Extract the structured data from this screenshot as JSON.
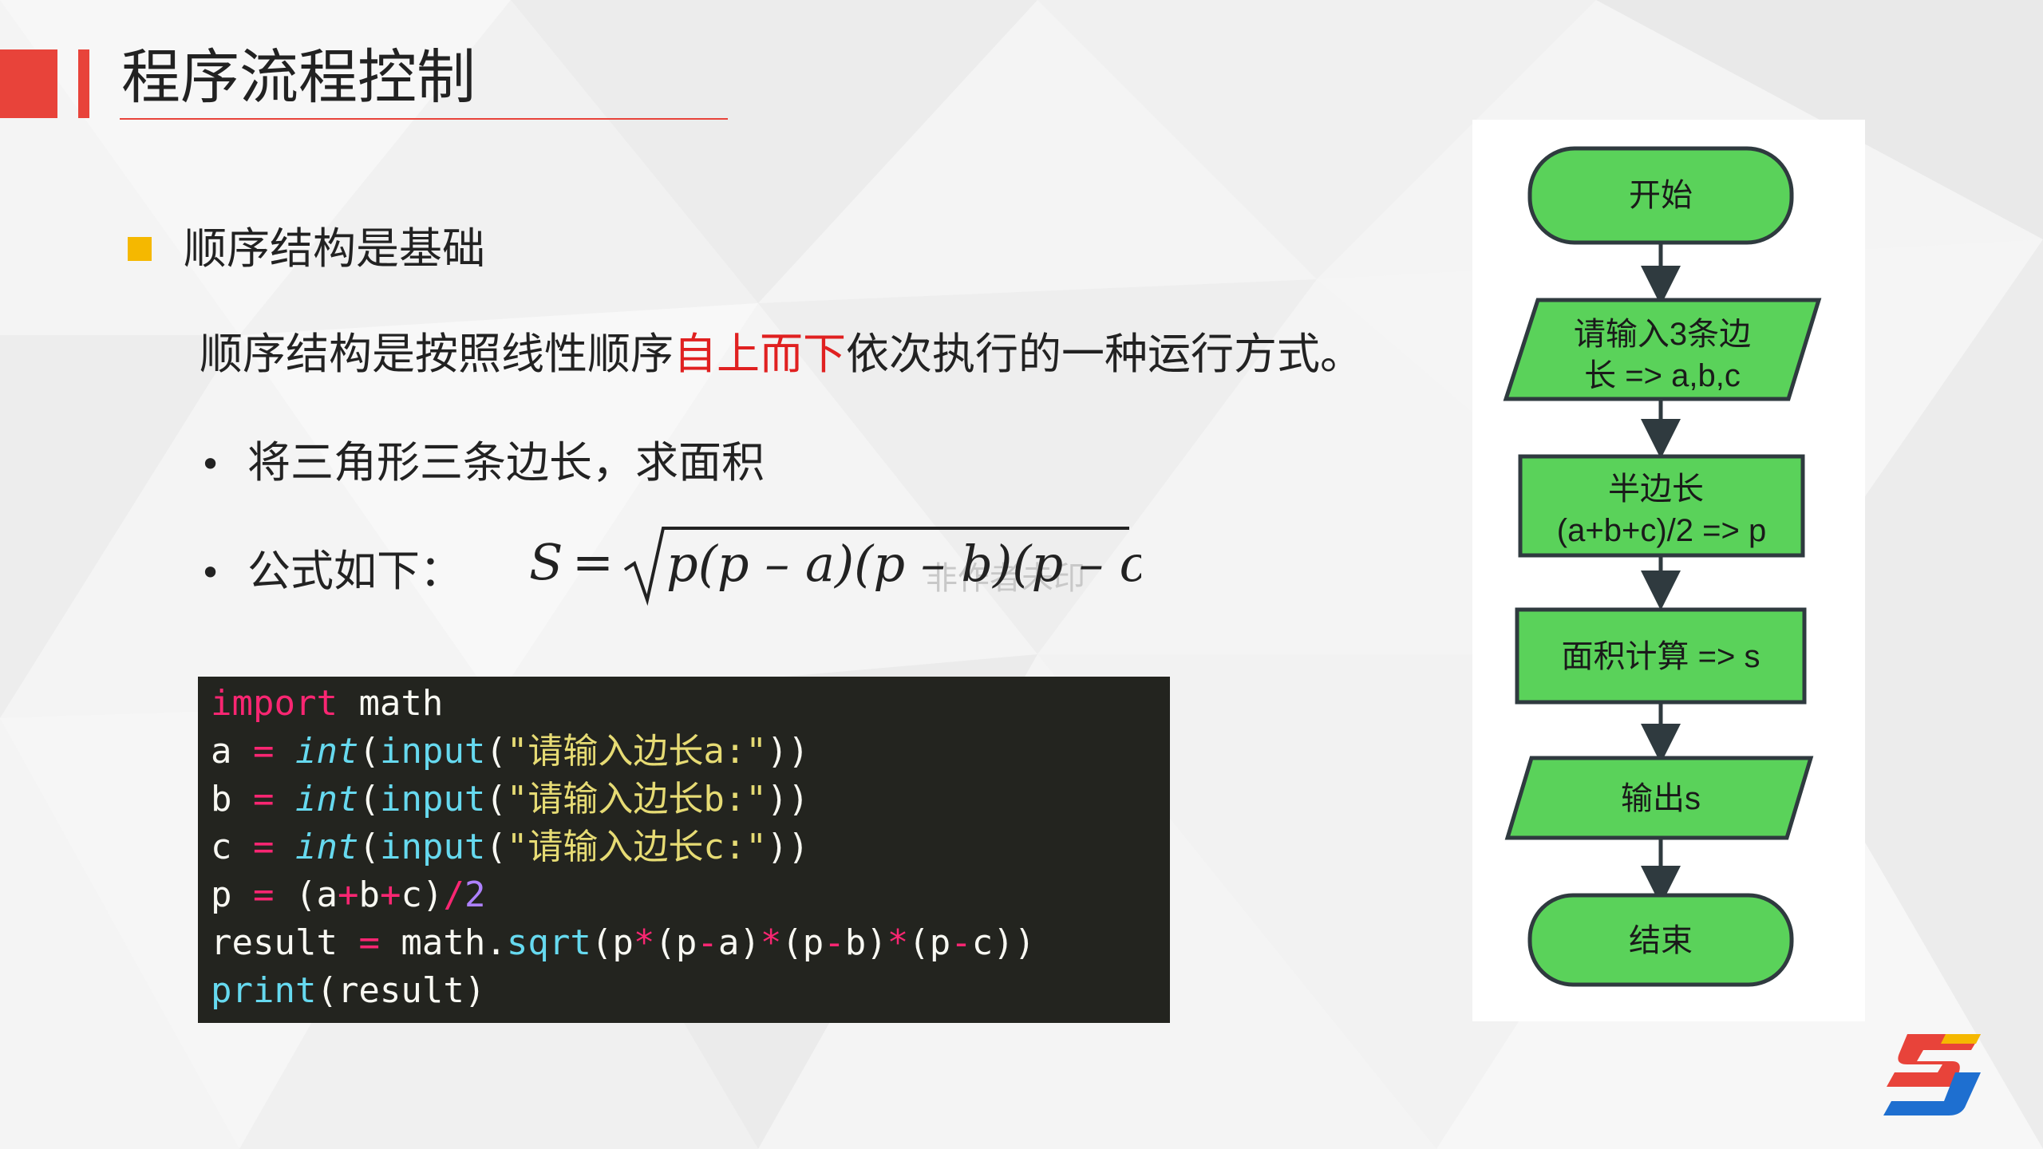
{
  "slide": {
    "title": "程序流程控制",
    "accent_color": "#e8433a",
    "bullet_color": "#f5b800",
    "heading": "顺序结构是基础",
    "description": {
      "before": "顺序结构是按照线性顺序",
      "highlight": "自上而下",
      "after": "依次执行的一种运行方式。",
      "highlight_color": "#e02020"
    },
    "items": [
      {
        "dot": "•",
        "text": "将三角形三条边长，求面积"
      },
      {
        "dot": "•",
        "text": "公式如下："
      }
    ],
    "formula": "S = √p(p – a)(p – b)(p – c)",
    "formula_watermark": "非作者未印"
  },
  "code": {
    "language": "python",
    "lines": [
      [
        {
          "t": "import",
          "c": "kw"
        },
        {
          "t": " math",
          "c": ""
        }
      ],
      [
        {
          "t": "a ",
          "c": ""
        },
        {
          "t": "=",
          "c": "op"
        },
        {
          "t": " ",
          "c": ""
        },
        {
          "t": "int",
          "c": "bi"
        },
        {
          "t": "(",
          "c": ""
        },
        {
          "t": "input",
          "c": "fn"
        },
        {
          "t": "(",
          "c": ""
        },
        {
          "t": "\"请输入边长a:\"",
          "c": "str"
        },
        {
          "t": "))",
          "c": ""
        }
      ],
      [
        {
          "t": "b ",
          "c": ""
        },
        {
          "t": "=",
          "c": "op"
        },
        {
          "t": " ",
          "c": ""
        },
        {
          "t": "int",
          "c": "bi"
        },
        {
          "t": "(",
          "c": ""
        },
        {
          "t": "input",
          "c": "fn"
        },
        {
          "t": "(",
          "c": ""
        },
        {
          "t": "\"请输入边长b:\"",
          "c": "str"
        },
        {
          "t": "))",
          "c": ""
        }
      ],
      [
        {
          "t": "c ",
          "c": ""
        },
        {
          "t": "=",
          "c": "op"
        },
        {
          "t": " ",
          "c": ""
        },
        {
          "t": "int",
          "c": "bi"
        },
        {
          "t": "(",
          "c": ""
        },
        {
          "t": "input",
          "c": "fn"
        },
        {
          "t": "(",
          "c": ""
        },
        {
          "t": "\"请输入边长c:\"",
          "c": "str"
        },
        {
          "t": "))",
          "c": ""
        }
      ],
      [
        {
          "t": "p ",
          "c": ""
        },
        {
          "t": "=",
          "c": "op"
        },
        {
          "t": " (a",
          "c": ""
        },
        {
          "t": "+",
          "c": "op"
        },
        {
          "t": "b",
          "c": ""
        },
        {
          "t": "+",
          "c": "op"
        },
        {
          "t": "c)",
          "c": ""
        },
        {
          "t": "/",
          "c": "op"
        },
        {
          "t": "2",
          "c": "num"
        }
      ],
      [
        {
          "t": "result ",
          "c": ""
        },
        {
          "t": "=",
          "c": "op"
        },
        {
          "t": " math.",
          "c": ""
        },
        {
          "t": "sqrt",
          "c": "fn"
        },
        {
          "t": "(p",
          "c": ""
        },
        {
          "t": "*",
          "c": "op"
        },
        {
          "t": "(p",
          "c": ""
        },
        {
          "t": "-",
          "c": "op"
        },
        {
          "t": "a)",
          "c": ""
        },
        {
          "t": "*",
          "c": "op"
        },
        {
          "t": "(p",
          "c": ""
        },
        {
          "t": "-",
          "c": "op"
        },
        {
          "t": "b)",
          "c": ""
        },
        {
          "t": "*",
          "c": "op"
        },
        {
          "t": "(p",
          "c": ""
        },
        {
          "t": "-",
          "c": "op"
        },
        {
          "t": "c))",
          "c": ""
        }
      ],
      [
        {
          "t": "print",
          "c": "fn"
        },
        {
          "t": "(result)",
          "c": ""
        }
      ]
    ]
  },
  "flowchart": {
    "fill": "#5ad25a",
    "stroke": "#2f3a3f",
    "nodes": [
      {
        "id": "start",
        "shape": "terminal",
        "lines": [
          "开始"
        ]
      },
      {
        "id": "input",
        "shape": "parallelogram",
        "lines": [
          "请输入3条边",
          "长 => a,b,c"
        ]
      },
      {
        "id": "half",
        "shape": "rect",
        "lines": [
          "半边长",
          "(a+b+c)/2 => p"
        ]
      },
      {
        "id": "area",
        "shape": "rect",
        "lines": [
          "面积计算 => s"
        ]
      },
      {
        "id": "output",
        "shape": "parallelogram",
        "lines": [
          "输出s"
        ]
      },
      {
        "id": "end",
        "shape": "terminal",
        "lines": [
          "结束"
        ]
      }
    ]
  },
  "logo": {
    "name": "brand-logo",
    "colors": [
      "#e8433a",
      "#f5b800",
      "#1e6fd0"
    ]
  }
}
